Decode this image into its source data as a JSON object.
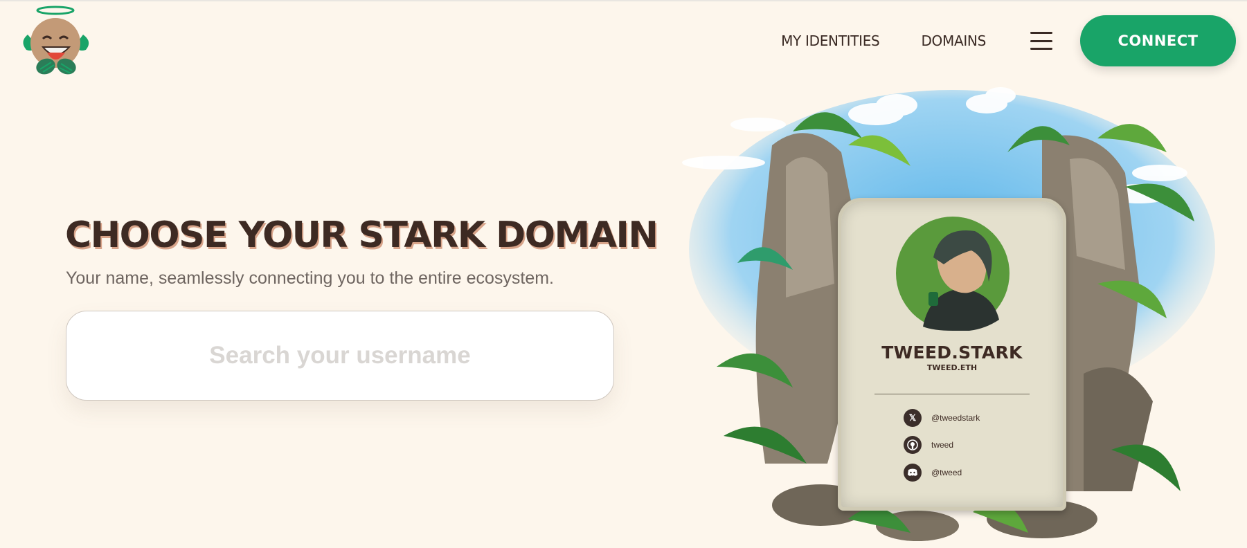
{
  "header": {
    "nav": {
      "identities_label": "MY IDENTITIES",
      "domains_label": "DOMAINS"
    },
    "connect_label": "CONNECT"
  },
  "hero": {
    "title": "CHOOSE YOUR STARK DOMAIN",
    "subtitle": "Your name, seamlessly connecting you to the entire ecosystem.",
    "search_placeholder": "Search your username"
  },
  "card": {
    "title": "TWEED.STARK",
    "subtitle": "TWEED.ETH",
    "socials": [
      {
        "icon": "x-icon",
        "handle": "@tweedstark"
      },
      {
        "icon": "github-icon",
        "handle": "tweed"
      },
      {
        "icon": "discord-icon",
        "handle": "@tweed"
      }
    ]
  },
  "colors": {
    "background": "#fdf6ec",
    "accent": "#19a468",
    "title_text": "#3d2a23"
  }
}
